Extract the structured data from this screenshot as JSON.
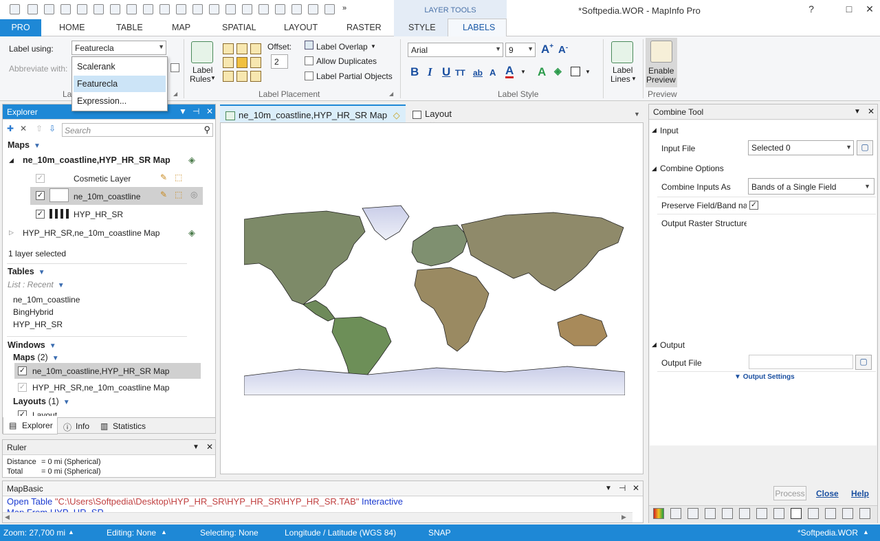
{
  "window": {
    "title": "*Softpedia.WOR - MapInfo Pro",
    "layer_tools_label": "LAYER TOOLS",
    "minimize": "?",
    "maximize": "□",
    "close": "✕"
  },
  "tabs": {
    "pro": "PRO",
    "home": "HOME",
    "table": "TABLE",
    "map": "MAP",
    "spatial": "SPATIAL",
    "layout": "LAYOUT",
    "raster": "RASTER",
    "style": "STYLE",
    "labels": "LABELS"
  },
  "ribbon": {
    "label_using_label": "Label using:",
    "label_using_value": "Featurecla",
    "abbreviate_label": "Abbreviate with:",
    "group_label_partial": "La",
    "label_rules": [
      "Label",
      "Rules"
    ],
    "offset_label": "Offset:",
    "offset_value": "2",
    "label_overlap": "Label Overlap",
    "allow_duplicates": "Allow Duplicates",
    "label_partial_objects": "Label Partial Objects",
    "group_label_placement": "Label Placement",
    "font_name": "Arial",
    "font_size": "9",
    "group_label_style": "Label Style",
    "label_lines": [
      "Label",
      "Lines"
    ],
    "enable_preview": [
      "Enable",
      "Preview"
    ],
    "group_preview": "Preview"
  },
  "dropdown": {
    "items": [
      "Scalerank",
      "Featurecla",
      "Expression..."
    ],
    "selected": "Featurecla"
  },
  "explorer": {
    "title": "Explorer",
    "search_placeholder": "Search",
    "maps_header": "Maps",
    "map1_name": "ne_10m_coastline,HYP_HR_SR Map",
    "layers": [
      "Cosmetic Layer",
      "ne_10m_coastline",
      "HYP_HR_SR"
    ],
    "map2_name": "HYP_HR_SR,ne_10m_coastline Map",
    "selection_status": "1 layer selected",
    "tables_header": "Tables",
    "list_recent": "List : Recent",
    "tables": [
      "ne_10m_coastline",
      "BingHybrid",
      "HYP_HR_SR"
    ],
    "windows_header": "Windows",
    "maps_sub": "Maps",
    "maps_count": "(2)",
    "window_maps": [
      "ne_10m_coastline,HYP_HR_SR Map",
      "HYP_HR_SR,ne_10m_coastline Map"
    ],
    "layouts_sub": "Layouts",
    "layouts_count": "(1)",
    "layout_item": "Layout",
    "bottom_tabs": [
      "Explorer",
      "Info",
      "Statistics"
    ]
  },
  "ruler": {
    "title": "Ruler",
    "distance_label": "Distance",
    "distance_value": "= 0 mi (Spherical)",
    "total_label": "Total",
    "total_value": "= 0 mi (Spherical)"
  },
  "doc_tabs": {
    "map_tab": "ne_10m_coastline,HYP_HR_SR Map",
    "layout_tab": "Layout"
  },
  "mapbasic": {
    "title": "MapBasic",
    "line1_keyword": "Open Table",
    "line1_path": "\"C:\\Users\\Softpedia\\Desktop\\HYP_HR_SR\\HYP_HR_SR\\HYP_HR_SR.TAB\"",
    "line1_tail": "Interactive",
    "line2": "Map From HYP_HR_SR"
  },
  "combine": {
    "title": "Combine Tool",
    "input_section": "Input",
    "input_file_label": "Input File",
    "input_file_value": "Selected 0",
    "options_section": "Combine Options",
    "combine_as_label": "Combine Inputs As",
    "combine_as_value": "Bands of a Single Field",
    "preserve_label": "Preserve Field/Band na",
    "output_structure_label": "Output Raster Structure",
    "output_section": "Output",
    "output_file_label": "Output File",
    "output_settings": "Output Settings",
    "process": "Process",
    "close": "Close",
    "help": "Help"
  },
  "status": {
    "zoom": "Zoom: 27,700 mi",
    "editing": "Editing: None",
    "selecting": "Selecting: None",
    "projection": "Longitude / Latitude (WGS 84)",
    "snap": "SNAP",
    "workspace": "*Softpedia.WOR"
  }
}
